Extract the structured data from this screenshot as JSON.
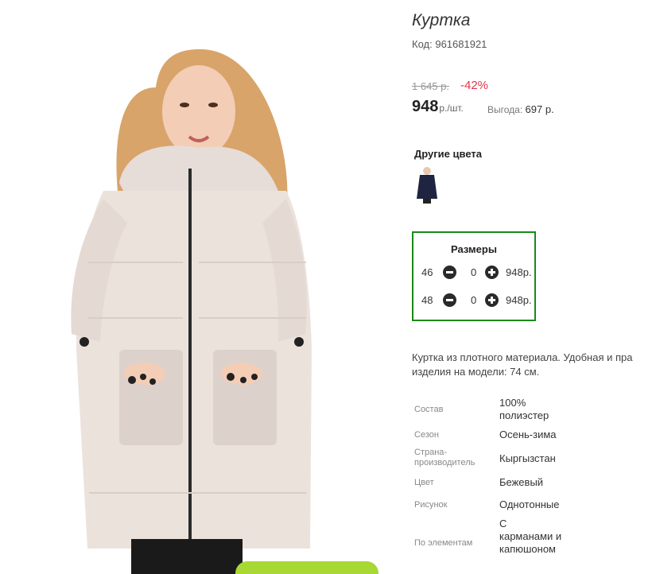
{
  "product": {
    "title": "Куртка",
    "code_label": "Код:",
    "code_value": "961681921",
    "old_price": "1 645 р.",
    "discount": "-42%",
    "price": "948",
    "price_unit": "р./шт.",
    "benefit_label": "Выгода:",
    "benefit_value": "697 р.",
    "accent_discount_color": "#e0364b",
    "sizes_border_color": "#1a8a1a"
  },
  "other_colors": {
    "title": "Другие цвета",
    "swatches": [
      {
        "icon": "navy-jacket-thumbnail",
        "color": "#1f2540"
      }
    ]
  },
  "sizes": {
    "title": "Размеры",
    "rows": [
      {
        "size": "46",
        "qty": "0",
        "price": "948р."
      },
      {
        "size": "48",
        "qty": "0",
        "price": "948р."
      }
    ]
  },
  "description": {
    "line1": "Куртка из плотного материала. Удобная и пра",
    "line2": "изделия на модели: 74 см."
  },
  "properties": [
    {
      "key": "Состав",
      "value": "100% полиэстер"
    },
    {
      "key": "Сезон",
      "value": "Осень-зима"
    },
    {
      "key": "Страна-производитель",
      "value": "Кыргызстан"
    },
    {
      "key": "Цвет",
      "value": "Бежевый"
    },
    {
      "key": "Рисунок",
      "value": "Однотонные"
    },
    {
      "key": "По элементам",
      "value": "С карманами и капюшоном"
    }
  ]
}
